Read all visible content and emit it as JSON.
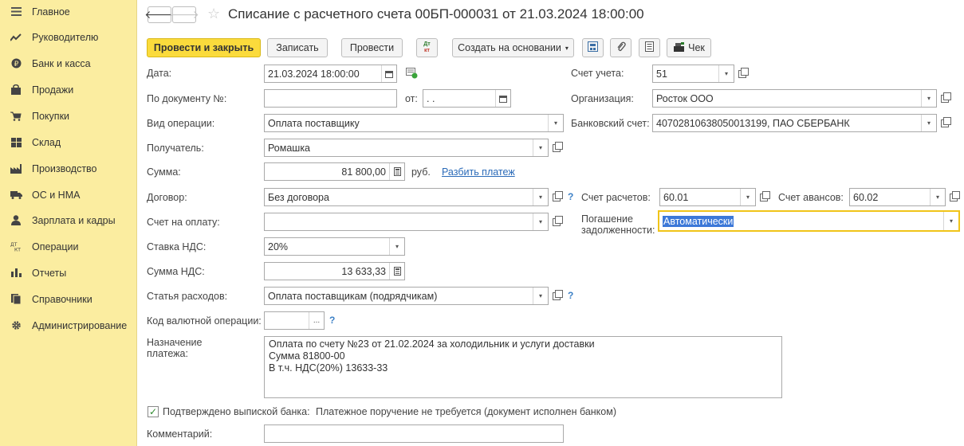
{
  "sidebar": {
    "items": [
      {
        "label": "Главное",
        "icon": "menu-icon"
      },
      {
        "label": "Руководителю",
        "icon": "trend-icon"
      },
      {
        "label": "Банк и касса",
        "icon": "coin-icon"
      },
      {
        "label": "Продажи",
        "icon": "bag-icon"
      },
      {
        "label": "Покупки",
        "icon": "cart-icon"
      },
      {
        "label": "Склад",
        "icon": "warehouse-icon"
      },
      {
        "label": "Производство",
        "icon": "factory-icon"
      },
      {
        "label": "ОС и НМА",
        "icon": "truck-icon"
      },
      {
        "label": "Зарплата и кадры",
        "icon": "person-icon"
      },
      {
        "label": "Операции",
        "icon": "dt-kt-icon"
      },
      {
        "label": "Отчеты",
        "icon": "bar-chart-icon"
      },
      {
        "label": "Справочники",
        "icon": "book-icon"
      },
      {
        "label": "Администрирование",
        "icon": "gear-icon"
      }
    ]
  },
  "header": {
    "back": "🡐",
    "forward": "🡒",
    "star": "☆",
    "title": "Списание с расчетного счета 00БП-000031 от 21.03.2024 18:00:00"
  },
  "toolbar": {
    "post_close": "Провести и закрыть",
    "save": "Записать",
    "post": "Провести",
    "dtkt_top": "Дт",
    "dtkt_bottom": "кт",
    "create_based": "Создать на основании",
    "check": "Чек"
  },
  "form": {
    "date_label": "Дата:",
    "date_value": "21.03.2024 18:00:00",
    "doc_no_label": "По документу №:",
    "doc_no_value": "",
    "from_label": "от:",
    "from_value": " .  .",
    "op_type_label": "Вид операции:",
    "op_type_value": "Оплата поставщику",
    "recipient_label": "Получатель:",
    "recipient_value": "Ромашка",
    "amount_label": "Сумма:",
    "amount_value": "81 800,00",
    "currency": "руб.",
    "split_link": "Разбить платеж",
    "contract_label": "Договор:",
    "contract_value": "Без договора",
    "invoice_label": "Счет на оплату:",
    "invoice_value": "",
    "vat_rate_label": "Ставка НДС:",
    "vat_rate_value": "20%",
    "vat_amount_label": "Сумма НДС:",
    "vat_amount_value": "13 633,33",
    "expense_label": "Статья расходов:",
    "expense_value": "Оплата поставщикам (подрядчикам)",
    "currency_op_label": "Код валютной операции:",
    "currency_op_value": "",
    "purpose_label": "Назначение платежа:",
    "purpose_lines": [
      "Оплата по счету №23 от 21.02.2024 за холодильник и услуги доставки",
      "Сумма 81800-00",
      "В т.ч. НДС(20%) 13633-33"
    ],
    "confirmed_label": "Подтверждено выпиской банка:",
    "confirmed_note": "Платежное поручение не требуется (документ исполнен банком)",
    "comment_label": "Комментарий:",
    "comment_value": "",
    "account_label": "Счет учета:",
    "account_value": "51",
    "org_label": "Организация:",
    "org_value": "Росток ООО",
    "bank_label": "Банковский счет:",
    "bank_value": "40702810638050013199, ПАО СБЕРБАНК",
    "settle_label": "Счет расчетов:",
    "settle_value": "60.01",
    "advance_label": "Счет авансов:",
    "advance_value": "60.02",
    "repay_label": "Погашение задолженности:",
    "repay_value": "Автоматически"
  },
  "glyphs": {
    "dropdown": "▾",
    "ellipsis": "...",
    "question": "?",
    "check": "✓"
  }
}
